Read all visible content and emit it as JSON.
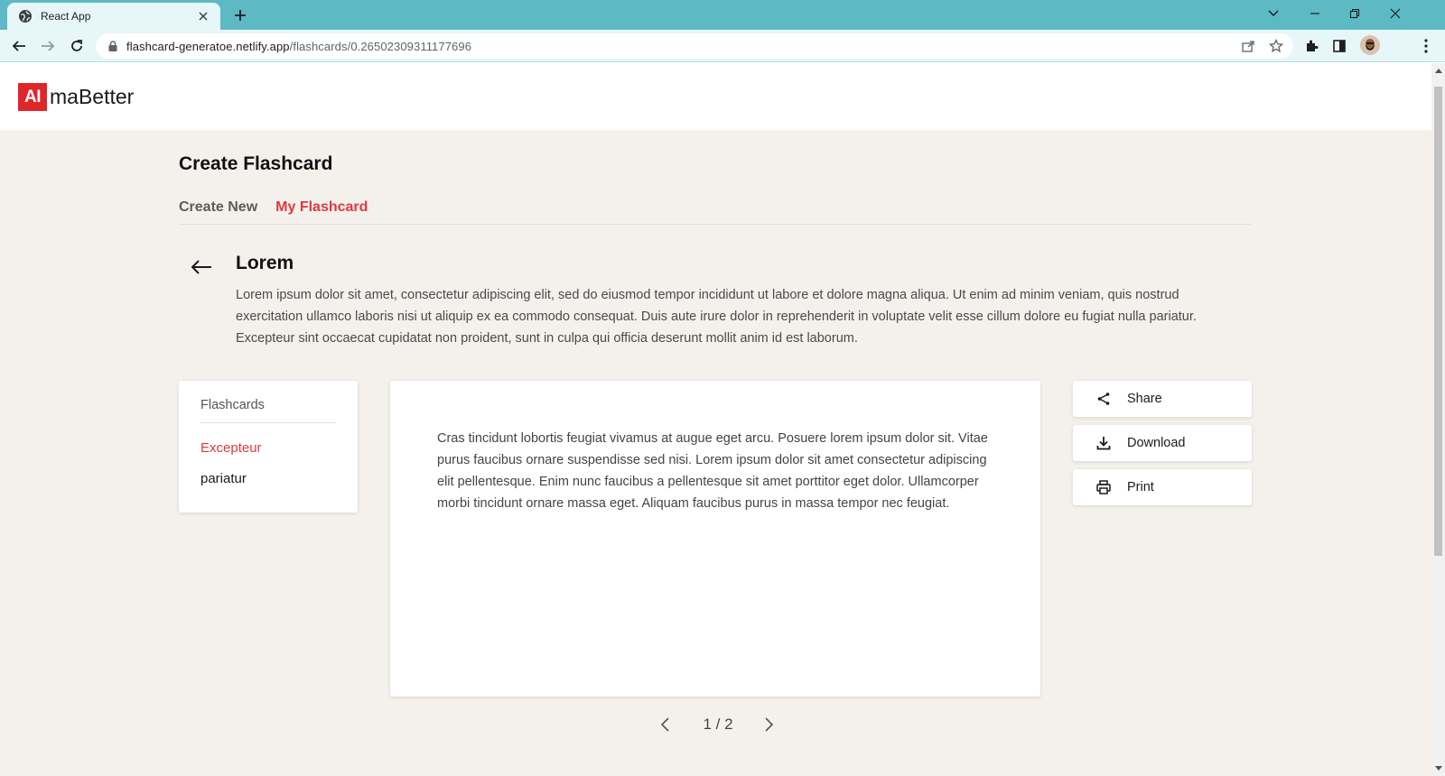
{
  "browser": {
    "tab_title": "React App",
    "url_host": "flashcard-generatoe.netlify.app",
    "url_path": "/flashcards/0.26502309311177696"
  },
  "app": {
    "logo_mark": "AI",
    "logo_text": "maBetter",
    "brand_color": "#e0252b",
    "accent_color": "#e0393e"
  },
  "page": {
    "title": "Create Flashcard",
    "tabs": [
      {
        "label": "Create New",
        "active": false
      },
      {
        "label": "My Flashcard",
        "active": true
      }
    ]
  },
  "group": {
    "title": "Lorem",
    "description": "Lorem ipsum dolor sit amet, consectetur adipiscing elit, sed do eiusmod tempor incididunt ut labore et dolore magna aliqua. Ut enim ad minim veniam, quis nostrud exercitation ullamco laboris nisi ut aliquip ex ea commodo consequat. Duis aute irure dolor in reprehenderit in voluptate velit esse cillum dolore eu fugiat nulla pariatur. Excepteur sint occaecat cupidatat non proident, sunt in culpa qui officia deserunt mollit anim id est laborum."
  },
  "flashcards": {
    "heading": "Flashcards",
    "items": [
      {
        "label": "Excepteur",
        "active": true
      },
      {
        "label": "pariatur",
        "active": false
      }
    ]
  },
  "card": {
    "text": "Cras tincidunt lobortis feugiat vivamus at augue eget arcu. Posuere lorem ipsum dolor sit. Vitae purus faucibus ornare suspendisse sed nisi. Lorem ipsum dolor sit amet consectetur adipiscing elit pellentesque. Enim nunc faucibus a pellentesque sit amet porttitor eget dolor. Ullamcorper morbi tincidunt ornare massa eget. Aliquam faucibus purus in massa tempor nec feugiat."
  },
  "actions": [
    {
      "label": "Share",
      "icon": "share-icon"
    },
    {
      "label": "Download",
      "icon": "download-icon"
    },
    {
      "label": "Print",
      "icon": "print-icon"
    }
  ],
  "pager": {
    "text": "1 / 2",
    "current": 1,
    "total": 2
  }
}
